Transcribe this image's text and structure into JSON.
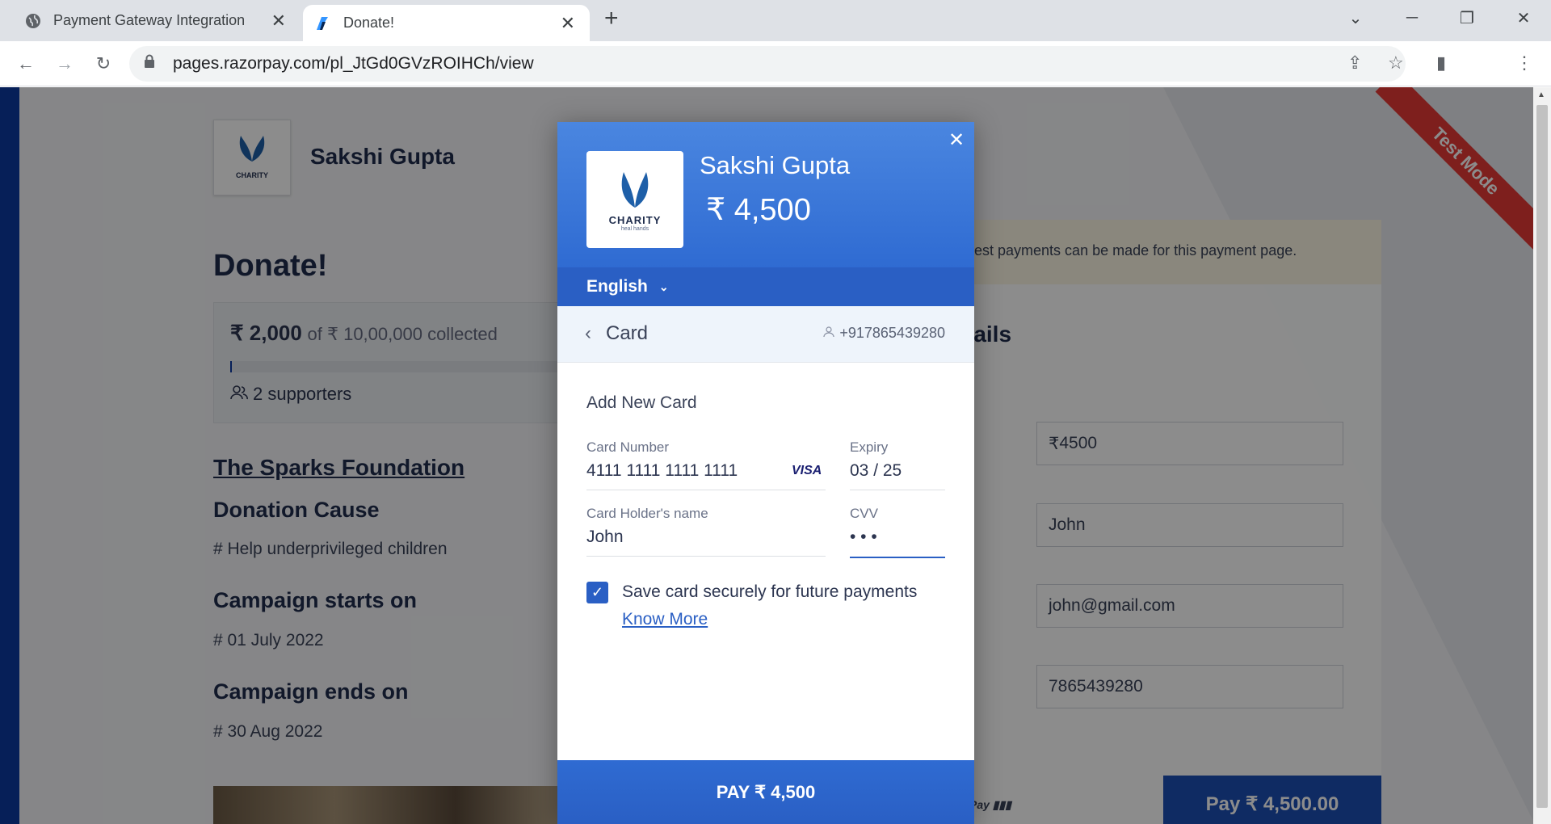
{
  "browser": {
    "tabs": [
      {
        "title": "Payment Gateway Integration",
        "icon": "globe-icon"
      },
      {
        "title": "Donate!",
        "icon": "razorpay-icon"
      }
    ],
    "url": "pages.razorpay.com/pl_JtGd0GVzROIHCh/view"
  },
  "page": {
    "merchant_name": "Sakshi Gupta",
    "title": "Donate!",
    "collected_amount": "₹ 2,000",
    "collected_suffix": "of ₹ 10,00,000 collected",
    "progress_fraction": 0.002,
    "supporters": "2 supporters",
    "org_link": "The Sparks Foundation",
    "donation_cause_heading": "Donation Cause",
    "donation_cause": "# Help underprivileged children",
    "starts_heading": "Campaign starts on",
    "starts_value": "# 01 July 2022",
    "ends_heading": "Campaign ends on",
    "ends_value": "# 30 Aug 2022",
    "notice_text": "est payments can be made for this payment page.",
    "details_heading_partial": "tails",
    "fields": {
      "amount": "4500",
      "name": "John",
      "email": "john@gmail.com",
      "phone": "7865439280"
    },
    "pay_button": "Pay ₹ 4,500.00",
    "ribbon": "Test Mode"
  },
  "checkout": {
    "merchant_name": "Sakshi Gupta",
    "amount": "₹ 4,500",
    "logo_text": "CHARITY",
    "language": "English",
    "method": "Card",
    "contact": "+917865439280",
    "section_title": "Add New Card",
    "card_number_label": "Card Number",
    "card_number": "4111 1111 1111 1111",
    "card_brand": "VISA",
    "expiry_label": "Expiry",
    "expiry": "03 / 25",
    "holder_label": "Card Holder's name",
    "holder": "John",
    "cvv_label": "CVV",
    "cvv": "• • •",
    "save_card_label": "Save card securely for future payments",
    "save_card_checked": true,
    "know_more": "Know More",
    "pay_button": "PAY ₹ 4,500"
  }
}
